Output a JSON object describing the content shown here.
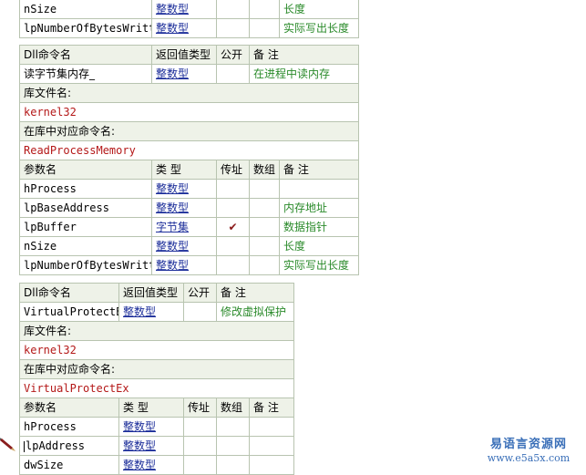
{
  "colors": {
    "type_link": "#1c2e9a",
    "remark": "#2a8a2a",
    "lib_name": "#b41818",
    "header_bg": "#eef2e8",
    "border": "#b8c4b0",
    "watermark": "#3a6fb8"
  },
  "labels": {
    "dll_cmd_name": "Dll命令名",
    "return_type": "返回值类型",
    "public": "公开",
    "remark": "备 注",
    "lib_file_name": "库文件名:",
    "lib_cmd_name": "在库中对应命令名:",
    "param_name": "参数名",
    "type": "类 型",
    "by_ref": "传址",
    "array": "数组"
  },
  "table_top": {
    "params": [
      {
        "name": "nSize",
        "type": "整数型",
        "by_ref": "",
        "array": "",
        "remark": "长度"
      },
      {
        "name": "lpNumberOfBytesWritten",
        "type": "整数型",
        "by_ref": "",
        "array": "",
        "remark": "实际写出长度"
      }
    ]
  },
  "table_read": {
    "cmd": {
      "name": "读字节集内存_",
      "return_type": "整数型",
      "public": "",
      "remark": "在进程中读内存"
    },
    "lib_file": "kernel32",
    "lib_cmd": "ReadProcessMemory",
    "params": [
      {
        "name": "hProcess",
        "type": "整数型",
        "by_ref": "",
        "array": "",
        "remark": ""
      },
      {
        "name": "lpBaseAddress",
        "type": "整数型",
        "by_ref": "",
        "array": "",
        "remark": "内存地址"
      },
      {
        "name": "lpBuffer",
        "type": "字节集",
        "by_ref": "✔",
        "array": "",
        "remark": "数据指针"
      },
      {
        "name": "nSize",
        "type": "整数型",
        "by_ref": "",
        "array": "",
        "remark": "长度"
      },
      {
        "name": "lpNumberOfBytesWritten",
        "type": "整数型",
        "by_ref": "",
        "array": "",
        "remark": "实际写出长度"
      }
    ]
  },
  "table_protect": {
    "cmd": {
      "name": "VirtualProtectEx",
      "return_type": "整数型",
      "public": "",
      "remark": "修改虚拟保护"
    },
    "lib_file": "kernel32",
    "lib_cmd": "VirtualProtectEx",
    "params": [
      {
        "name": "hProcess",
        "type": "整数型",
        "by_ref": "",
        "array": "",
        "remark": ""
      },
      {
        "name": "lpAddress",
        "type": "整数型",
        "by_ref": "",
        "array": "",
        "remark": ""
      },
      {
        "name": "dwSize",
        "type": "整数型",
        "by_ref": "",
        "array": "",
        "remark": ""
      }
    ]
  },
  "watermark": {
    "line1": "易语言资源网",
    "line2": "www.e5a5x.com"
  },
  "icons": {
    "cursor": "pencil-cursor-icon",
    "check": "checkmark-icon"
  }
}
